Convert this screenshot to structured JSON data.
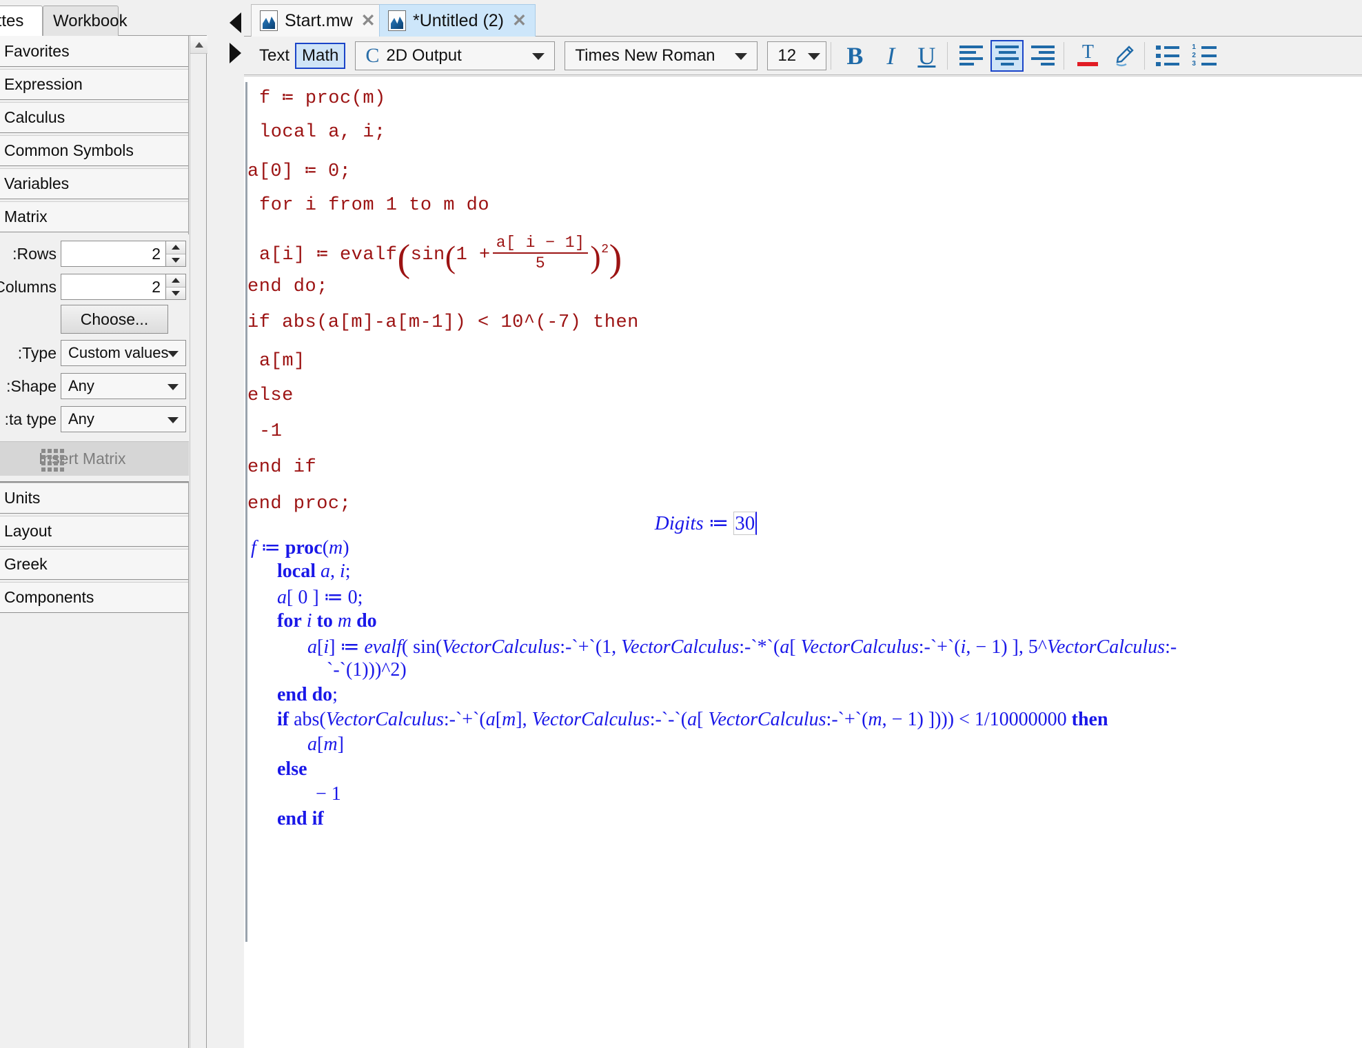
{
  "palette_panel": {
    "tabs": [
      {
        "label": "lettes",
        "active": true
      },
      {
        "label": "Workbook",
        "active": false
      }
    ],
    "items": [
      {
        "label": "Favorites"
      },
      {
        "label": "Expression"
      },
      {
        "label": "Calculus"
      },
      {
        "label": "Common Symbols"
      },
      {
        "label": "Variables"
      },
      {
        "label": "Matrix"
      }
    ],
    "bottom_items": [
      {
        "label": "Units"
      },
      {
        "label": "Layout"
      },
      {
        "label": "Greek"
      },
      {
        "label": "Components"
      }
    ],
    "matrix": {
      "rows_label": "Rows:",
      "rows_value": "2",
      "columns_label": "Columns:",
      "columns_value": "2",
      "choose_label": "Choose...",
      "type_label": "Type:",
      "type_value": "Custom values",
      "shape_label": "Shape:",
      "shape_value": "Any",
      "datatype_label": "ta type:",
      "datatype_value": "Any",
      "insert_label": "Insert Matrix"
    }
  },
  "document": {
    "tabs": [
      {
        "label": "Start.mw",
        "close": "✕",
        "active": false
      },
      {
        "label": "*Untitled (2)",
        "close": "✕",
        "active": true
      }
    ]
  },
  "toolbar": {
    "mode_text": "Text",
    "mode_math": "Math",
    "style_icon": "C",
    "style_value": "2D Output",
    "font_value": "Times New Roman",
    "size_value": "12",
    "bold": "B",
    "italic": "I",
    "underline": "U"
  },
  "worksheet": {
    "input_lines": [
      {
        "text": "f ≔ proc(m)"
      },
      {
        "text": "local   a, i;"
      },
      {
        "text": "a[0]  ≔  0;"
      },
      {
        "text": "for i from 1 to m do"
      },
      {
        "text": "end do;"
      },
      {
        "text": "if abs(a[m]-a[m-1])  <  10^(-7)  then"
      },
      {
        "text": "a[m]"
      },
      {
        "text": "else"
      },
      {
        "text": "-1"
      },
      {
        "text": "end if"
      },
      {
        "text": "end proc;"
      }
    ],
    "formula_line": {
      "lhs": "a[i] ≔ evalf",
      "sin": "sin",
      "one_plus": "1 +",
      "numerator": "a[ i − 1]",
      "denominator": "5",
      "exponent": "2"
    },
    "digits_line": {
      "name": "Digits",
      "assign": "≔",
      "value": "30"
    },
    "output_lines": [
      {
        "indent": 0,
        "html": "<span class=\"var\">f</span> ≔ <span class=\"kw\">proc</span>(<span class=\"var\">m</span>)"
      },
      {
        "indent": 1,
        "html": "<span class=\"kw\">local</span> <span class=\"var\">a</span>, <span class=\"var\">i</span>;"
      },
      {
        "indent": 1,
        "html": "<span class=\"var\">a</span>[ 0 ] ≔ 0;"
      },
      {
        "indent": 1,
        "html": "<span class=\"kw\">for</span> <span class=\"var\">i</span> <span class=\"kw\">to</span> <span class=\"var\">m</span> <span class=\"kw\">do</span>"
      },
      {
        "indent": 2,
        "html": "<span class=\"var\">a</span>[<span class=\"var\">i</span>] ≔ <span class=\"var\">evalf</span>( sin(<span class=\"var\">VectorCalculus</span>:-`+`(1, <span class=\"var\">VectorCalculus</span>:-`*`(<span class=\"var\">a</span>[ <span class=\"var\">VectorCalculus</span>:-`+`(<span class=\"var\">i</span>, − 1) ], 5^<span class=\"var\">VectorCalculus</span>:-"
      },
      {
        "indent": 3,
        "html": "`-`(1)))^2)"
      },
      {
        "indent": 1,
        "html": "<span class=\"kw\">end do</span>;"
      },
      {
        "indent": 1,
        "html": "<span class=\"kw\">if</span> abs(<span class=\"var\">VectorCalculus</span>:-`+`(<span class=\"var\">a</span>[<span class=\"var\">m</span>], <span class=\"var\">VectorCalculus</span>:-`-`(<span class=\"var\">a</span>[ <span class=\"var\">VectorCalculus</span>:-`+`(<span class=\"var\">m</span>, − 1) ]))) < 1/10000000 <span class=\"kw\">then</span>"
      },
      {
        "indent": 2,
        "html": "<span class=\"var\">a</span>[<span class=\"var\">m</span>]"
      },
      {
        "indent": 1,
        "html": "<span class=\"kw\">else</span>"
      },
      {
        "indent": 2,
        "html": "− 1"
      },
      {
        "indent": 1,
        "html": "<span class=\"kw\">end if</span>"
      }
    ]
  },
  "colors": {
    "input_red": "#9c1313",
    "output_blue": "#1a18e8",
    "accent_blue": "#1f6aa8",
    "selection_blue": "#cde6fa",
    "panel_gray": "#f0f0f0"
  }
}
